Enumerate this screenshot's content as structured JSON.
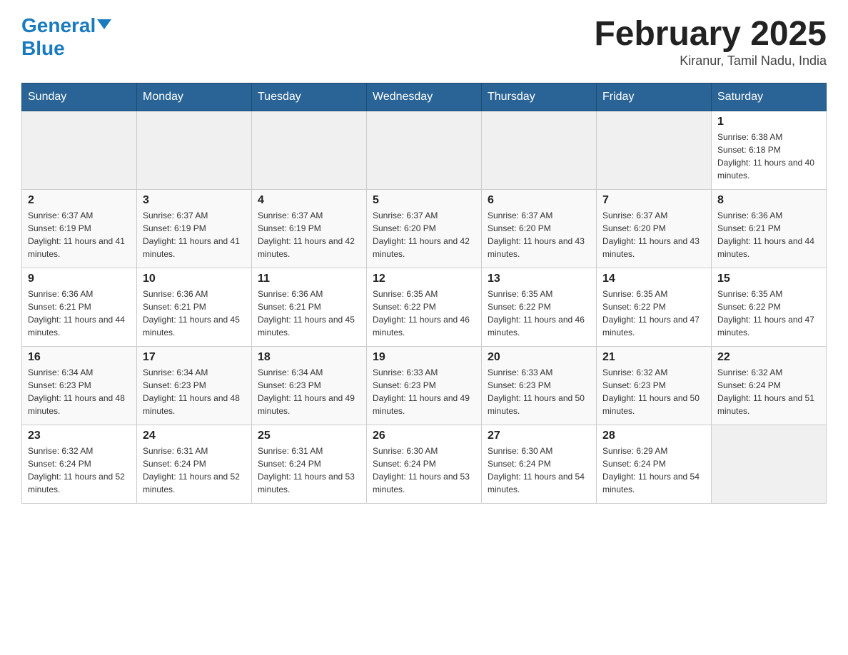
{
  "header": {
    "logo_general": "General",
    "logo_blue": "Blue",
    "month_title": "February 2025",
    "location": "Kiranur, Tamil Nadu, India"
  },
  "days_of_week": [
    "Sunday",
    "Monday",
    "Tuesday",
    "Wednesday",
    "Thursday",
    "Friday",
    "Saturday"
  ],
  "weeks": [
    [
      {
        "day": "",
        "info": ""
      },
      {
        "day": "",
        "info": ""
      },
      {
        "day": "",
        "info": ""
      },
      {
        "day": "",
        "info": ""
      },
      {
        "day": "",
        "info": ""
      },
      {
        "day": "",
        "info": ""
      },
      {
        "day": "1",
        "info": "Sunrise: 6:38 AM\nSunset: 6:18 PM\nDaylight: 11 hours and 40 minutes."
      }
    ],
    [
      {
        "day": "2",
        "info": "Sunrise: 6:37 AM\nSunset: 6:19 PM\nDaylight: 11 hours and 41 minutes."
      },
      {
        "day": "3",
        "info": "Sunrise: 6:37 AM\nSunset: 6:19 PM\nDaylight: 11 hours and 41 minutes."
      },
      {
        "day": "4",
        "info": "Sunrise: 6:37 AM\nSunset: 6:19 PM\nDaylight: 11 hours and 42 minutes."
      },
      {
        "day": "5",
        "info": "Sunrise: 6:37 AM\nSunset: 6:20 PM\nDaylight: 11 hours and 42 minutes."
      },
      {
        "day": "6",
        "info": "Sunrise: 6:37 AM\nSunset: 6:20 PM\nDaylight: 11 hours and 43 minutes."
      },
      {
        "day": "7",
        "info": "Sunrise: 6:37 AM\nSunset: 6:20 PM\nDaylight: 11 hours and 43 minutes."
      },
      {
        "day": "8",
        "info": "Sunrise: 6:36 AM\nSunset: 6:21 PM\nDaylight: 11 hours and 44 minutes."
      }
    ],
    [
      {
        "day": "9",
        "info": "Sunrise: 6:36 AM\nSunset: 6:21 PM\nDaylight: 11 hours and 44 minutes."
      },
      {
        "day": "10",
        "info": "Sunrise: 6:36 AM\nSunset: 6:21 PM\nDaylight: 11 hours and 45 minutes."
      },
      {
        "day": "11",
        "info": "Sunrise: 6:36 AM\nSunset: 6:21 PM\nDaylight: 11 hours and 45 minutes."
      },
      {
        "day": "12",
        "info": "Sunrise: 6:35 AM\nSunset: 6:22 PM\nDaylight: 11 hours and 46 minutes."
      },
      {
        "day": "13",
        "info": "Sunrise: 6:35 AM\nSunset: 6:22 PM\nDaylight: 11 hours and 46 minutes."
      },
      {
        "day": "14",
        "info": "Sunrise: 6:35 AM\nSunset: 6:22 PM\nDaylight: 11 hours and 47 minutes."
      },
      {
        "day": "15",
        "info": "Sunrise: 6:35 AM\nSunset: 6:22 PM\nDaylight: 11 hours and 47 minutes."
      }
    ],
    [
      {
        "day": "16",
        "info": "Sunrise: 6:34 AM\nSunset: 6:23 PM\nDaylight: 11 hours and 48 minutes."
      },
      {
        "day": "17",
        "info": "Sunrise: 6:34 AM\nSunset: 6:23 PM\nDaylight: 11 hours and 48 minutes."
      },
      {
        "day": "18",
        "info": "Sunrise: 6:34 AM\nSunset: 6:23 PM\nDaylight: 11 hours and 49 minutes."
      },
      {
        "day": "19",
        "info": "Sunrise: 6:33 AM\nSunset: 6:23 PM\nDaylight: 11 hours and 49 minutes."
      },
      {
        "day": "20",
        "info": "Sunrise: 6:33 AM\nSunset: 6:23 PM\nDaylight: 11 hours and 50 minutes."
      },
      {
        "day": "21",
        "info": "Sunrise: 6:32 AM\nSunset: 6:23 PM\nDaylight: 11 hours and 50 minutes."
      },
      {
        "day": "22",
        "info": "Sunrise: 6:32 AM\nSunset: 6:24 PM\nDaylight: 11 hours and 51 minutes."
      }
    ],
    [
      {
        "day": "23",
        "info": "Sunrise: 6:32 AM\nSunset: 6:24 PM\nDaylight: 11 hours and 52 minutes."
      },
      {
        "day": "24",
        "info": "Sunrise: 6:31 AM\nSunset: 6:24 PM\nDaylight: 11 hours and 52 minutes."
      },
      {
        "day": "25",
        "info": "Sunrise: 6:31 AM\nSunset: 6:24 PM\nDaylight: 11 hours and 53 minutes."
      },
      {
        "day": "26",
        "info": "Sunrise: 6:30 AM\nSunset: 6:24 PM\nDaylight: 11 hours and 53 minutes."
      },
      {
        "day": "27",
        "info": "Sunrise: 6:30 AM\nSunset: 6:24 PM\nDaylight: 11 hours and 54 minutes."
      },
      {
        "day": "28",
        "info": "Sunrise: 6:29 AM\nSunset: 6:24 PM\nDaylight: 11 hours and 54 minutes."
      },
      {
        "day": "",
        "info": ""
      }
    ]
  ]
}
